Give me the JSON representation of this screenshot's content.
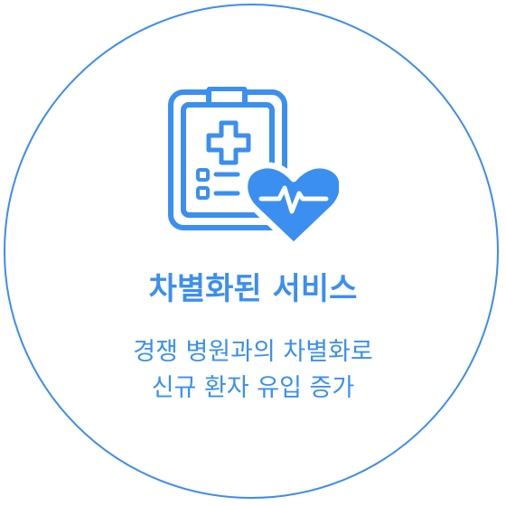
{
  "card": {
    "icon": "clipboard-medical-heart-icon",
    "accent_color": "#3a8ff0",
    "title": "차별화된 서비스",
    "description_lines": [
      "경쟁 병원과의 차별화로",
      "신규 환자 유입 증가"
    ]
  }
}
